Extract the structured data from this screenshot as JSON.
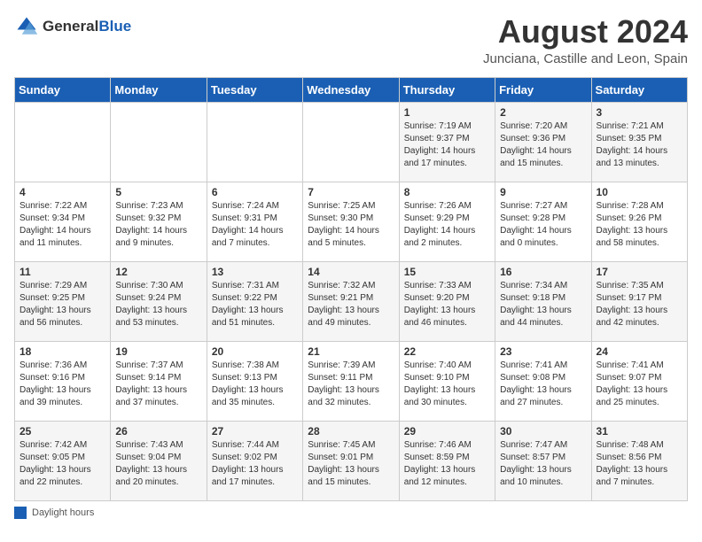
{
  "logo": {
    "general": "General",
    "blue": "Blue"
  },
  "title": "August 2024",
  "subtitle": "Junciana, Castille and Leon, Spain",
  "days_of_week": [
    "Sunday",
    "Monday",
    "Tuesday",
    "Wednesday",
    "Thursday",
    "Friday",
    "Saturday"
  ],
  "footer": {
    "label": "Daylight hours"
  },
  "weeks": [
    [
      {
        "day": "",
        "info": ""
      },
      {
        "day": "",
        "info": ""
      },
      {
        "day": "",
        "info": ""
      },
      {
        "day": "",
        "info": ""
      },
      {
        "day": "1",
        "info": "Sunrise: 7:19 AM\nSunset: 9:37 PM\nDaylight: 14 hours\nand 17 minutes."
      },
      {
        "day": "2",
        "info": "Sunrise: 7:20 AM\nSunset: 9:36 PM\nDaylight: 14 hours\nand 15 minutes."
      },
      {
        "day": "3",
        "info": "Sunrise: 7:21 AM\nSunset: 9:35 PM\nDaylight: 14 hours\nand 13 minutes."
      }
    ],
    [
      {
        "day": "4",
        "info": "Sunrise: 7:22 AM\nSunset: 9:34 PM\nDaylight: 14 hours\nand 11 minutes."
      },
      {
        "day": "5",
        "info": "Sunrise: 7:23 AM\nSunset: 9:32 PM\nDaylight: 14 hours\nand 9 minutes."
      },
      {
        "day": "6",
        "info": "Sunrise: 7:24 AM\nSunset: 9:31 PM\nDaylight: 14 hours\nand 7 minutes."
      },
      {
        "day": "7",
        "info": "Sunrise: 7:25 AM\nSunset: 9:30 PM\nDaylight: 14 hours\nand 5 minutes."
      },
      {
        "day": "8",
        "info": "Sunrise: 7:26 AM\nSunset: 9:29 PM\nDaylight: 14 hours\nand 2 minutes."
      },
      {
        "day": "9",
        "info": "Sunrise: 7:27 AM\nSunset: 9:28 PM\nDaylight: 14 hours\nand 0 minutes."
      },
      {
        "day": "10",
        "info": "Sunrise: 7:28 AM\nSunset: 9:26 PM\nDaylight: 13 hours\nand 58 minutes."
      }
    ],
    [
      {
        "day": "11",
        "info": "Sunrise: 7:29 AM\nSunset: 9:25 PM\nDaylight: 13 hours\nand 56 minutes."
      },
      {
        "day": "12",
        "info": "Sunrise: 7:30 AM\nSunset: 9:24 PM\nDaylight: 13 hours\nand 53 minutes."
      },
      {
        "day": "13",
        "info": "Sunrise: 7:31 AM\nSunset: 9:22 PM\nDaylight: 13 hours\nand 51 minutes."
      },
      {
        "day": "14",
        "info": "Sunrise: 7:32 AM\nSunset: 9:21 PM\nDaylight: 13 hours\nand 49 minutes."
      },
      {
        "day": "15",
        "info": "Sunrise: 7:33 AM\nSunset: 9:20 PM\nDaylight: 13 hours\nand 46 minutes."
      },
      {
        "day": "16",
        "info": "Sunrise: 7:34 AM\nSunset: 9:18 PM\nDaylight: 13 hours\nand 44 minutes."
      },
      {
        "day": "17",
        "info": "Sunrise: 7:35 AM\nSunset: 9:17 PM\nDaylight: 13 hours\nand 42 minutes."
      }
    ],
    [
      {
        "day": "18",
        "info": "Sunrise: 7:36 AM\nSunset: 9:16 PM\nDaylight: 13 hours\nand 39 minutes."
      },
      {
        "day": "19",
        "info": "Sunrise: 7:37 AM\nSunset: 9:14 PM\nDaylight: 13 hours\nand 37 minutes."
      },
      {
        "day": "20",
        "info": "Sunrise: 7:38 AM\nSunset: 9:13 PM\nDaylight: 13 hours\nand 35 minutes."
      },
      {
        "day": "21",
        "info": "Sunrise: 7:39 AM\nSunset: 9:11 PM\nDaylight: 13 hours\nand 32 minutes."
      },
      {
        "day": "22",
        "info": "Sunrise: 7:40 AM\nSunset: 9:10 PM\nDaylight: 13 hours\nand 30 minutes."
      },
      {
        "day": "23",
        "info": "Sunrise: 7:41 AM\nSunset: 9:08 PM\nDaylight: 13 hours\nand 27 minutes."
      },
      {
        "day": "24",
        "info": "Sunrise: 7:41 AM\nSunset: 9:07 PM\nDaylight: 13 hours\nand 25 minutes."
      }
    ],
    [
      {
        "day": "25",
        "info": "Sunrise: 7:42 AM\nSunset: 9:05 PM\nDaylight: 13 hours\nand 22 minutes."
      },
      {
        "day": "26",
        "info": "Sunrise: 7:43 AM\nSunset: 9:04 PM\nDaylight: 13 hours\nand 20 minutes."
      },
      {
        "day": "27",
        "info": "Sunrise: 7:44 AM\nSunset: 9:02 PM\nDaylight: 13 hours\nand 17 minutes."
      },
      {
        "day": "28",
        "info": "Sunrise: 7:45 AM\nSunset: 9:01 PM\nDaylight: 13 hours\nand 15 minutes."
      },
      {
        "day": "29",
        "info": "Sunrise: 7:46 AM\nSunset: 8:59 PM\nDaylight: 13 hours\nand 12 minutes."
      },
      {
        "day": "30",
        "info": "Sunrise: 7:47 AM\nSunset: 8:57 PM\nDaylight: 13 hours\nand 10 minutes."
      },
      {
        "day": "31",
        "info": "Sunrise: 7:48 AM\nSunset: 8:56 PM\nDaylight: 13 hours\nand 7 minutes."
      }
    ]
  ]
}
